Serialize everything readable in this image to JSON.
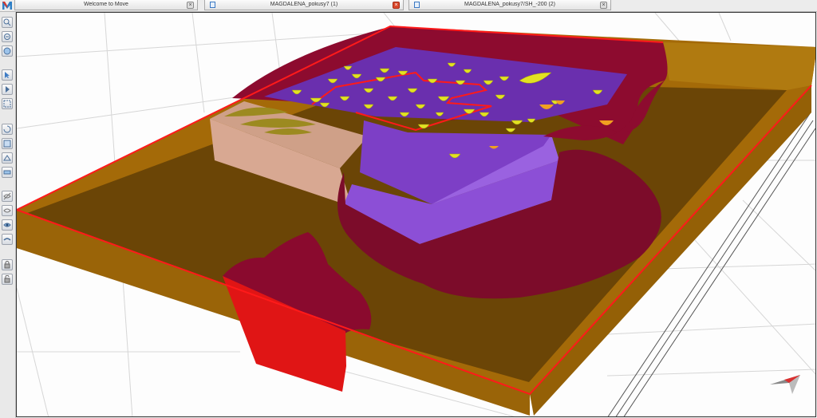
{
  "tabs": [
    {
      "label": "Welcome to Move",
      "close": "×",
      "active": false
    },
    {
      "label": "MAGDALENA_pokusy7 (1)",
      "close": "×",
      "active": true
    },
    {
      "label": "MAGDALENA_pokusy7/SH_-200 (2)",
      "close": "×",
      "active": false
    }
  ],
  "toolbar": {
    "tools": [
      "zoom-in-icon",
      "zoom-out-icon",
      "zoom-fit-icon",
      "select-icon",
      "pointer-icon",
      "box-select-icon",
      "rotate-icon",
      "pan-icon",
      "section-icon",
      "measure-icon",
      "hide-icon",
      "show-icon",
      "view-icon",
      "surface-icon",
      "lock-icon",
      "unlock-icon"
    ]
  },
  "colors": {
    "frame_orange": "#a46a08",
    "floor": "#6b4506",
    "crimson": "#8a0a2e",
    "purple": "#7d3fc6",
    "yellow": "#e2e222",
    "red_outline": "#ff1a1a"
  }
}
